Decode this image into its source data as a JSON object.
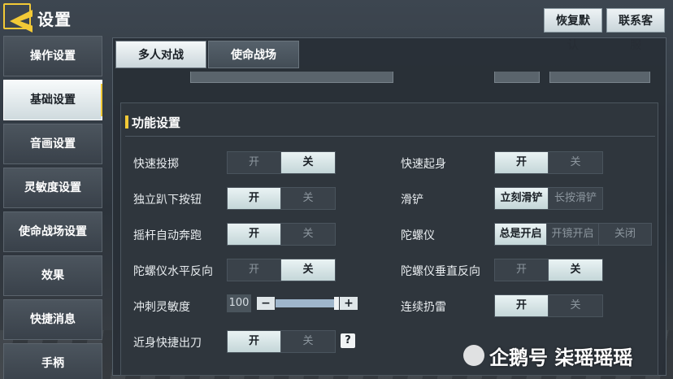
{
  "header": {
    "title": "设置",
    "restore_label": "恢复默认",
    "service_label": "联系客服"
  },
  "sidebar": {
    "items": [
      {
        "label": "操作设置"
      },
      {
        "label": "基础设置",
        "active": true
      },
      {
        "label": "音画设置"
      },
      {
        "label": "灵敏度设置"
      },
      {
        "label": "使命战场设置"
      },
      {
        "label": "效果"
      },
      {
        "label": "快捷消息"
      },
      {
        "label": "手柄"
      }
    ]
  },
  "tabs": [
    {
      "label": "多人对战",
      "active": true
    },
    {
      "label": "使命战场",
      "active": false
    }
  ],
  "section": {
    "title": "功能设置"
  },
  "settings": {
    "quick_throw": {
      "label": "快速投掷",
      "on": "开",
      "off": "关",
      "selected": "off"
    },
    "quick_getup": {
      "label": "快速起身",
      "on": "开",
      "off": "关",
      "selected": "on"
    },
    "separate_prone": {
      "label": "独立趴下按钮",
      "on": "开",
      "off": "关",
      "selected": "on"
    },
    "slide": {
      "label": "滑铲",
      "opt1": "立刻滑铲",
      "opt2": "长按滑铲",
      "selected": "opt1"
    },
    "auto_sprint": {
      "label": "摇杆自动奔跑",
      "on": "开",
      "off": "关",
      "selected": "on"
    },
    "gyro": {
      "label": "陀螺仪",
      "opt1": "总是开启",
      "opt2": "开镜开启",
      "opt3": "关闭",
      "selected": "opt1"
    },
    "gyro_h_invert": {
      "label": "陀螺仪水平反向",
      "on": "开",
      "off": "关",
      "selected": "off"
    },
    "gyro_v_invert": {
      "label": "陀螺仪垂直反向",
      "on": "开",
      "off": "关",
      "selected": "off"
    },
    "sprint_sensitivity": {
      "label": "冲刺灵敏度",
      "value": "100",
      "minus": "−",
      "plus": "+",
      "level": 1.0
    },
    "continuous_grenade": {
      "label": "连续扔雷",
      "on": "开",
      "off": "关",
      "selected": "on"
    },
    "melee": {
      "label": "近身快捷出刀",
      "on": "开",
      "off": "关",
      "selected": "on",
      "help": "?"
    }
  },
  "watermark": {
    "text": "企鹅号 柒瑶瑶瑶"
  },
  "colors": {
    "accent": "#f2c936",
    "selected_option": "#c4d6d8",
    "panel": "#2f363d"
  }
}
